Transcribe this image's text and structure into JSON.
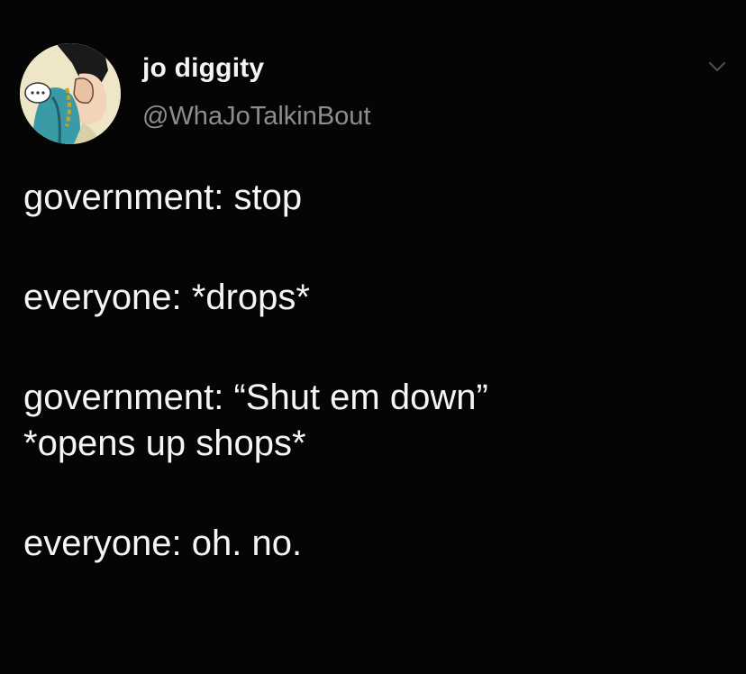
{
  "author": {
    "display_name": "jo diggity",
    "handle": "@WhaJoTalkinBout",
    "avatar_icon": "avatar-illustration-icon"
  },
  "menu": {
    "icon": "chevron-down-icon"
  },
  "tweet": {
    "lines": [
      "government: stop",
      "everyone: *drops*",
      "government: “Shut em down”",
      "*opens up shops*",
      "everyone: oh. no."
    ]
  },
  "colors": {
    "background": "#050505",
    "text": "#f5f5f5",
    "handle": "#8a8d91",
    "chevron": "#4a4d52"
  }
}
